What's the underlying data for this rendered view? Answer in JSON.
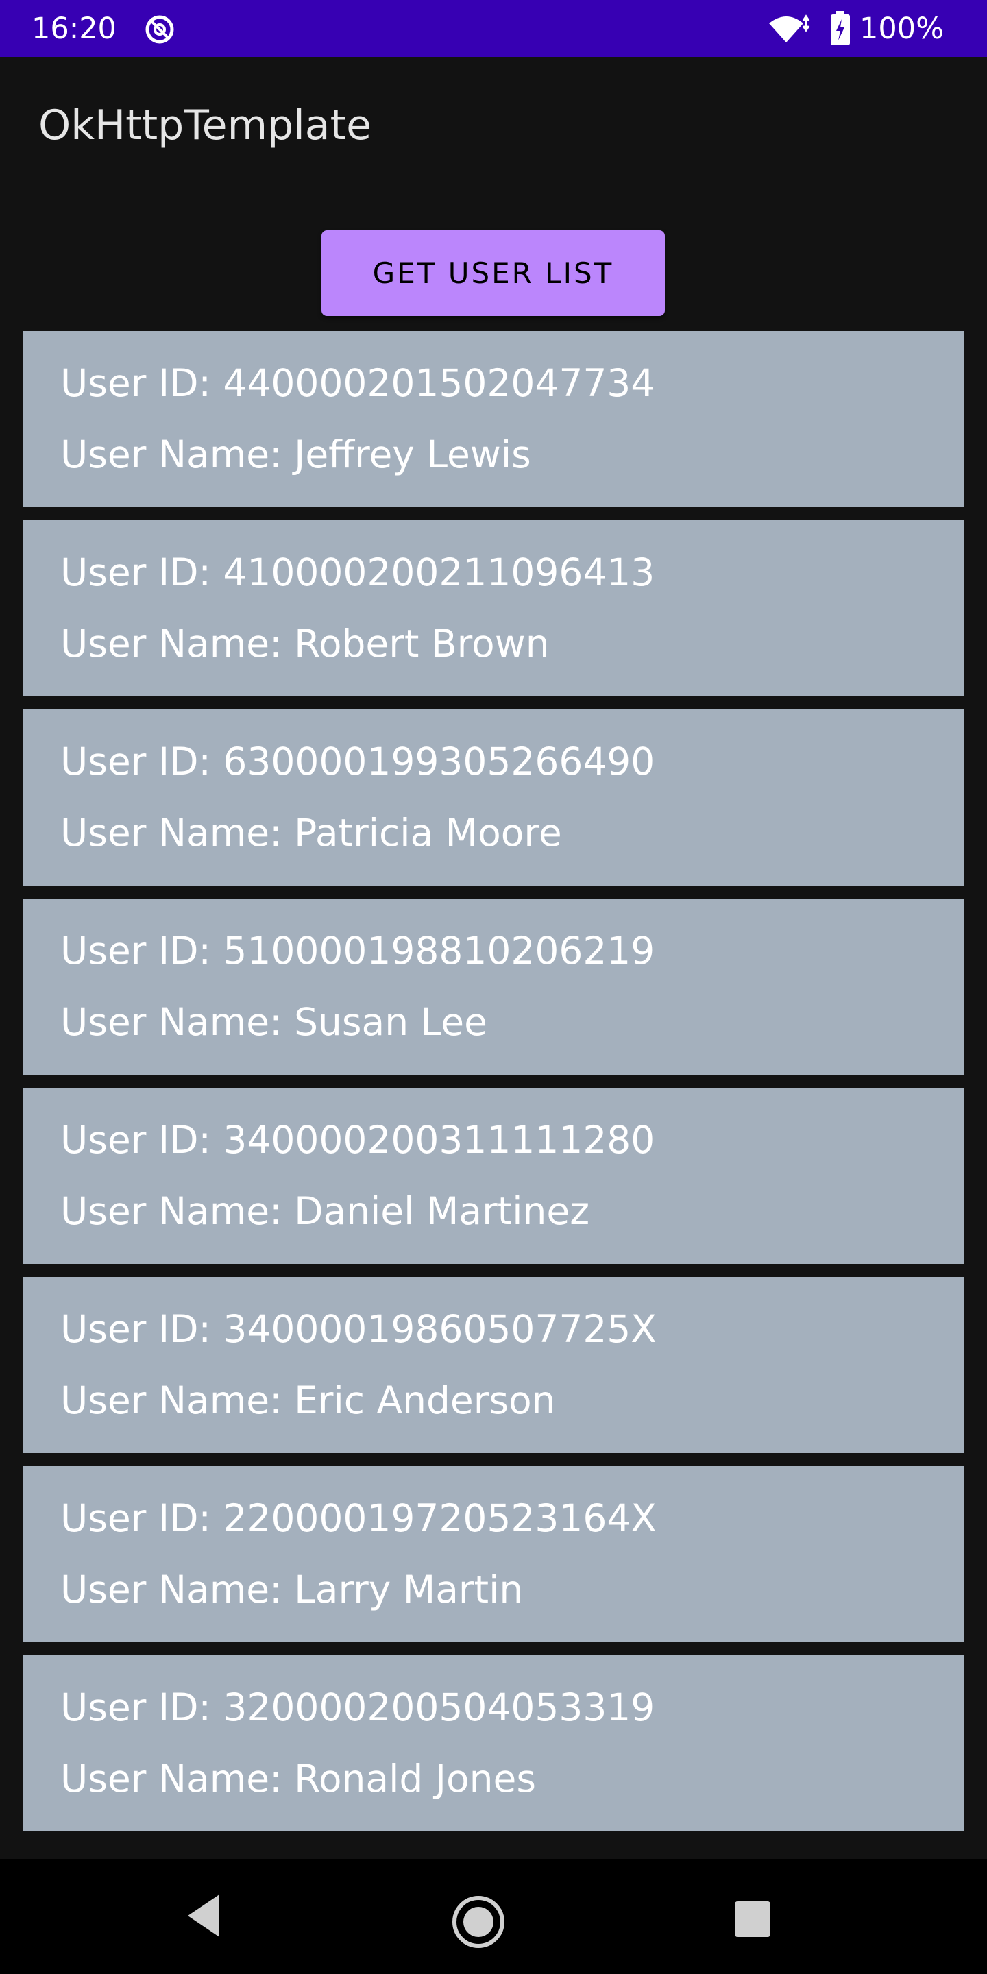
{
  "status_bar": {
    "time": "16:20",
    "battery": "100%",
    "icons": [
      "sync-icon",
      "wifi-icon",
      "battery-charging-icon"
    ],
    "background": "#3700b3"
  },
  "app_bar": {
    "title": "OkHttpTemplate"
  },
  "button": {
    "label": "GET USER LIST",
    "color": "#bb86fc"
  },
  "users": [
    {
      "id": "User ID: 440000201502047734",
      "name": "User Name: Jeffrey Lewis"
    },
    {
      "id": "User ID: 410000200211096413",
      "name": "User Name: Robert Brown"
    },
    {
      "id": "User ID: 630000199305266490",
      "name": "User Name: Patricia Moore"
    },
    {
      "id": "User ID: 510000198810206219",
      "name": "User Name: Susan Lee"
    },
    {
      "id": "User ID: 340000200311111280",
      "name": "User Name: Daniel Martinez"
    },
    {
      "id": "User ID: 34000019860507725X",
      "name": "User Name: Eric Anderson"
    },
    {
      "id": "User ID: 22000019720523164X",
      "name": "User Name: Larry Martin"
    },
    {
      "id": "User ID: 320000200504053319",
      "name": "User Name: Ronald Jones"
    }
  ],
  "card_color": "#a4b0bd",
  "nav_bar": {
    "icons": [
      "back-icon",
      "home-icon",
      "recents-icon"
    ]
  }
}
